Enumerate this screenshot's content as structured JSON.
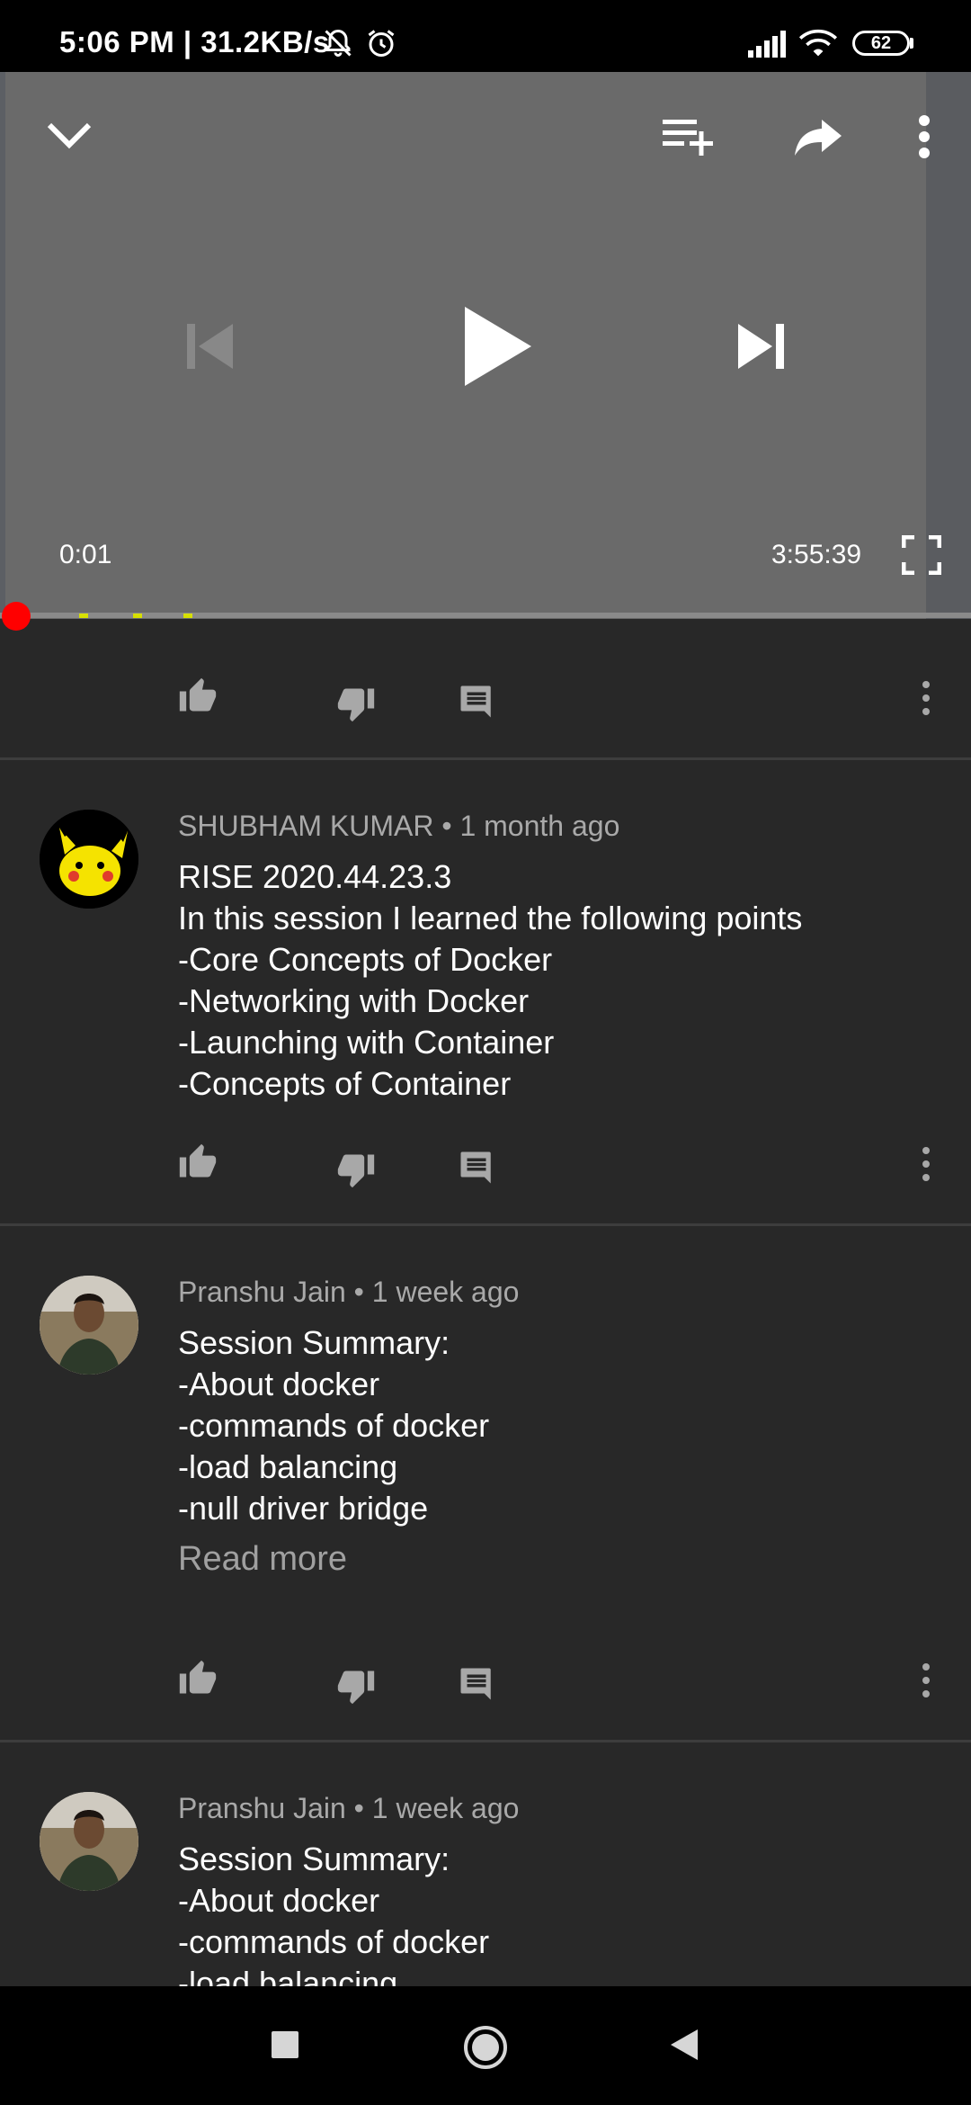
{
  "status_bar": {
    "time_and_speed": "5:06 PM | 31.2KB/s",
    "battery": "62"
  },
  "player": {
    "current_time": "0:01",
    "duration": "3:55:39",
    "progress": 0.0
  },
  "comments": [
    {
      "author": "SHUBHAM KUMAR",
      "age": "1 month ago",
      "lines": [
        "RISE 2020.44.23.3",
        "In this session I learned the following points",
        "-Core Concepts of Docker",
        "-Networking with Docker",
        "-Launching with Container",
        "-Concepts of Container"
      ]
    },
    {
      "author": "Pranshu Jain",
      "age": "1 week ago",
      "lines": [
        "Session Summary:",
        "-About docker",
        "-commands of docker",
        "-load balancing",
        "-null driver bridge"
      ],
      "read_more": "Read more"
    },
    {
      "author": "Pranshu Jain",
      "age": "1 week ago",
      "lines": [
        "Session Summary:",
        "-About docker",
        "-commands of docker",
        "-load balancing"
      ]
    }
  ],
  "icons": {
    "collapse": "chevron-down-icon",
    "add_to_queue": "playlist-add-icon",
    "share": "share-icon",
    "more": "more-vert-icon",
    "previous": "skip-previous-icon",
    "play": "play-icon",
    "next": "skip-next-icon",
    "fullscreen": "fullscreen-icon",
    "like": "thumb-up-icon",
    "dislike": "thumb-down-icon",
    "reply": "reply-icon"
  },
  "colors": {
    "background": "#282828",
    "player_bg": "#6a6a6a",
    "progress_played": "#ff0000",
    "ad_marker": "#d7e000",
    "meta_text": "#a9a9a9"
  }
}
